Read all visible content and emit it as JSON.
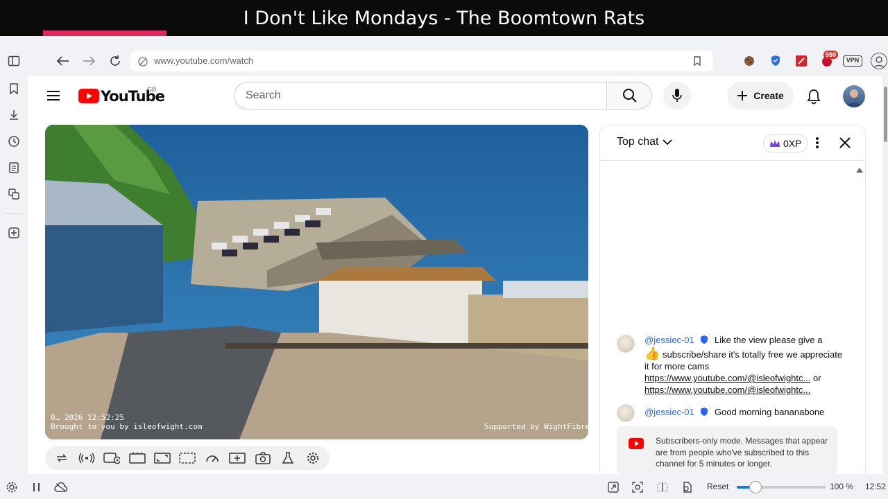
{
  "caption": {
    "text": "I Don't Like Mondays - The Boomtown Rats"
  },
  "browser": {
    "url": "www.youtube.com/watch",
    "extension_badge": "559",
    "vpn_label": "VPN"
  },
  "youtube": {
    "logo_text": "YouTube",
    "region": "GB",
    "search_placeholder": "Search",
    "create_label": "Create"
  },
  "video": {
    "overlay_datetime": "0… 2026 12:52:25",
    "overlay_credit": "Brought to you by isleofwight.com",
    "overlay_sponsor": "Supported by WightFibre"
  },
  "chat": {
    "mode_label": "Top chat",
    "xp_label": "0XP",
    "messages": [
      {
        "author": "@jessiec-01",
        "text1": "Like the view please give a",
        "text2": "subscribe/share it's totally free we appreciate it for more cams",
        "link1": "https://www.youtube.com/@isleofwightc...",
        "or": "or",
        "link2": "https://www.youtube.com/@isleofwightc..."
      },
      {
        "author": "@jessiec-01",
        "text": "Good morning bananabone"
      }
    ],
    "notice": "Subscribers-only mode. Messages that appear are from people who've subscribed to this channel for 5 minutes or longer."
  },
  "status_bar": {
    "reset_label": "Reset",
    "zoom": "100 %",
    "zoom_fraction": 0.2,
    "time": "12:52"
  }
}
